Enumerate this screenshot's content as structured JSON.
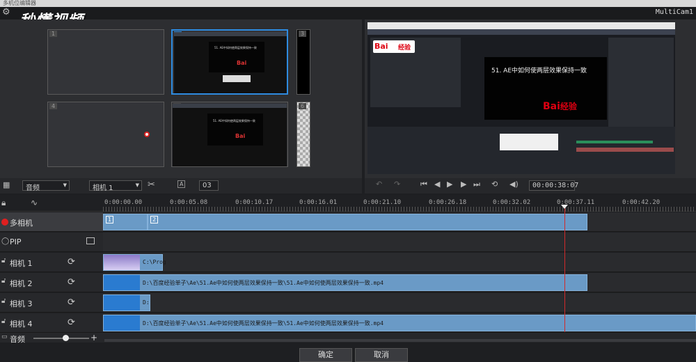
{
  "window": {
    "title": "多机位编辑器"
  },
  "watermark": "秒懂视频",
  "app_label": "MultiCam1",
  "sources": [
    {
      "num": "1"
    },
    {
      "num": "2"
    },
    {
      "num": "3"
    },
    {
      "num": "4"
    },
    {
      "num": "5"
    },
    {
      "num": "6"
    }
  ],
  "preview": {
    "small_caption": "51. AE中如何使两层效果保持一致",
    "big_caption": "51. AE中如何使两层效果保持一致",
    "logo_text": "Bai",
    "logo_suffix": "经验",
    "mini_logo": "秒懂视频"
  },
  "left_controls": {
    "audio_dropdown": "音频",
    "camera_dropdown": "相机 1",
    "layout_value": "03"
  },
  "right_controls": {
    "timecode": "00:00:38",
    "timecode_frames": "07"
  },
  "ruler": [
    "0:00:00.00",
    "0:00:05.08",
    "0:00:10.17",
    "0:00:16.01",
    "0:00:21.10",
    "0:00:26.18",
    "0:00:32.02",
    "0:00:37.11",
    "0:00:42.20"
  ],
  "tracks": [
    {
      "label": "多相机"
    },
    {
      "label": "PIP"
    },
    {
      "label": "相机 1",
      "clip_text": "C:\\Prog"
    },
    {
      "label": "相机 2",
      "clip_text": "D:\\百度经验单子\\Ae\\51.Ae中如何使两层效果保持一致\\51.Ae中如何使两层效果保持一致.mp4"
    },
    {
      "label": "相机 3",
      "clip_text": "D:"
    },
    {
      "label": "相机 4",
      "clip_text": "D:\\百度经验单子\\Ae\\51.Ae中如何使两层效果保持一致\\51.Ae中如何使两层效果保持一致.mp4"
    }
  ],
  "multicam_clips": [
    "1",
    "2"
  ],
  "audio_row": {
    "label": "音频"
  },
  "footer": {
    "ok": "确定",
    "cancel": "取消"
  },
  "colors": {
    "clip": "#6a9ac6",
    "playhead": "#d12a2a",
    "record": "#e02020",
    "selection": "#2e8be0"
  }
}
